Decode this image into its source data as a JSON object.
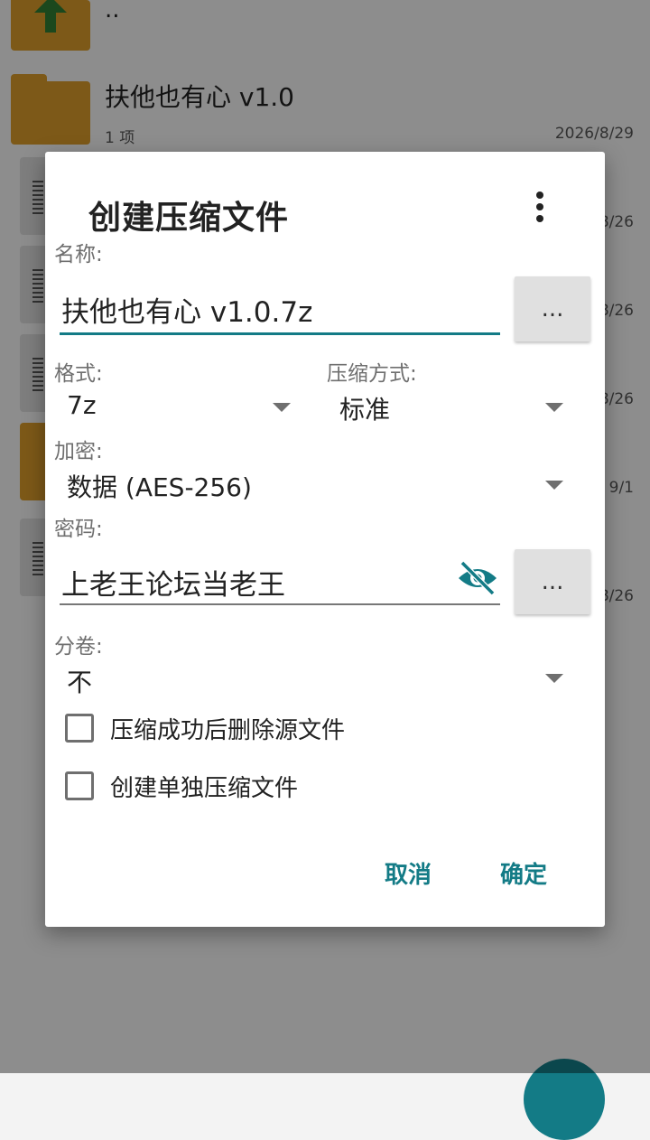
{
  "file_list": {
    "parent_dir": {
      "label": ".."
    },
    "folder": {
      "name": "扶他也有心 v1.0",
      "meta": "1 项",
      "date": "2026/8/29"
    },
    "row_dates": [
      "8/26",
      "8/26",
      "8/26",
      "9/1",
      "8/26"
    ]
  },
  "dialog": {
    "title": "创建压缩文件",
    "name_label": "名称:",
    "name_value": "扶他也有心 v1.0.7z",
    "browse_label": "...",
    "format_label": "格式:",
    "format_value": "7z",
    "compression_label": "压缩方式:",
    "compression_value": "标准",
    "encryption_label": "加密:",
    "encryption_value": "数据 (AES-256)",
    "password_label": "密码:",
    "password_value": "上老王论坛当老王",
    "password_button_label": "...",
    "split_label": "分卷:",
    "split_value": "不",
    "delete_after_label": "压缩成功后删除源文件",
    "separate_archive_label": "创建单独压缩文件",
    "cancel_label": "取消",
    "ok_label": "确定"
  },
  "colors": {
    "accent": "#137b86",
    "folder": "#d89a2a"
  }
}
